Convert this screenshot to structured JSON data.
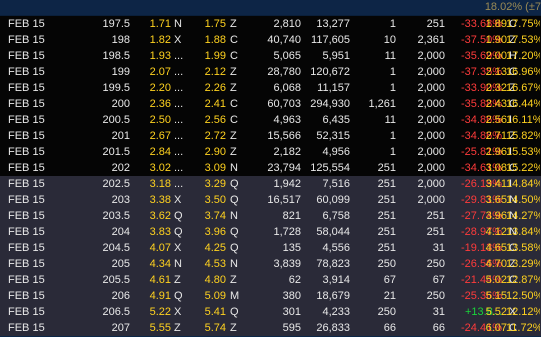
{
  "header": {
    "top_value": "18.02% (±7"
  },
  "rows": [
    {
      "exp": "FEB 15",
      "strike": "197.5",
      "bid": "1.71",
      "bid_x": "N",
      "ask": "1.75",
      "ask_x": "Z",
      "volume": "2,810",
      "open_int": "13,277",
      "size1": "1",
      "size2": "251",
      "pct_chg": "-33.68%",
      "last": "1.89",
      "last_x": "C",
      "iv": "17.75%",
      "zone": "itm"
    },
    {
      "exp": "FEB 15",
      "strike": "198",
      "bid": "1.82",
      "bid_x": "X",
      "ask": "1.88",
      "ask_x": "C",
      "volume": "40,740",
      "open_int": "117,605",
      "size1": "10",
      "size2": "2,361",
      "pct_chg": "-37.50%",
      "last": "1.90",
      "last_x": "Z",
      "iv": "17.53%",
      "zone": "itm"
    },
    {
      "exp": "FEB 15",
      "strike": "198.5",
      "bid": "1.93",
      "bid_x": "...",
      "ask": "1.99",
      "ask_x": "C",
      "volume": "5,065",
      "open_int": "5,951",
      "size1": "11",
      "size2": "2,000",
      "pct_chg": "-35.69%",
      "last": "2.00",
      "last_x": "H",
      "iv": "17.20%",
      "zone": "itm"
    },
    {
      "exp": "FEB 15",
      "strike": "199",
      "bid": "2.07",
      "bid_x": "...",
      "ask": "2.12",
      "ask_x": "Z",
      "volume": "28,780",
      "open_int": "120,672",
      "size1": "1",
      "size2": "2,000",
      "pct_chg": "-37.35%",
      "last": "2.13",
      "last_x": "C",
      "iv": "16.96%",
      "zone": "itm"
    },
    {
      "exp": "FEB 15",
      "strike": "199.5",
      "bid": "2.20",
      "bid_x": "...",
      "ask": "2.26",
      "ask_x": "Z",
      "volume": "6,068",
      "open_int": "11,157",
      "size1": "1",
      "size2": "2,000",
      "pct_chg": "-33.90%",
      "last": "2.32",
      "last_x": "Z",
      "iv": "16.67%",
      "zone": "itm"
    },
    {
      "exp": "FEB 15",
      "strike": "200",
      "bid": "2.36",
      "bid_x": "...",
      "ask": "2.41",
      "ask_x": "C",
      "volume": "60,703",
      "open_int": "294,930",
      "size1": "1,261",
      "size2": "2,000",
      "pct_chg": "-35.88%",
      "last": "2.43",
      "last_x": "C",
      "iv": "16.44%",
      "zone": "itm"
    },
    {
      "exp": "FEB 15",
      "strike": "200.5",
      "bid": "2.50",
      "bid_x": "...",
      "ask": "2.56",
      "ask_x": "C",
      "volume": "4,963",
      "open_int": "6,435",
      "size1": "11",
      "size2": "2,000",
      "pct_chg": "-34.86%",
      "last": "2.56",
      "last_x": "I",
      "iv": "16.11%",
      "zone": "itm"
    },
    {
      "exp": "FEB 15",
      "strike": "201",
      "bid": "2.67",
      "bid_x": "...",
      "ask": "2.72",
      "ask_x": "Z",
      "volume": "15,566",
      "open_int": "52,315",
      "size1": "1",
      "size2": "2,000",
      "pct_chg": "-34.86%",
      "last": "2.71",
      "last_x": "Z",
      "iv": "15.82%",
      "zone": "itm"
    },
    {
      "exp": "FEB 15",
      "strike": "201.5",
      "bid": "2.84",
      "bid_x": "...",
      "ask": "2.90",
      "ask_x": "Z",
      "volume": "2,182",
      "open_int": "4,956",
      "size1": "1",
      "size2": "2,000",
      "pct_chg": "-25.81%",
      "last": "2.96",
      "last_x": "I",
      "iv": "15.53%",
      "zone": "itm"
    },
    {
      "exp": "FEB 15",
      "strike": "202",
      "bid": "3.02",
      "bid_x": "...",
      "ask": "3.09",
      "ask_x": "N",
      "volume": "23,794",
      "open_int": "125,554",
      "size1": "251",
      "size2": "2,000",
      "pct_chg": "-34.61%",
      "last": "3.08",
      "last_x": "C",
      "iv": "15.22%",
      "zone": "itm"
    },
    {
      "exp": "FEB 15",
      "strike": "202.5",
      "bid": "3.18",
      "bid_x": "...",
      "ask": "3.29",
      "ask_x": "Q",
      "volume": "1,942",
      "open_int": "7,516",
      "size1": "251",
      "size2": "2,000",
      "pct_chg": "-26.19%",
      "last": "3.41",
      "last_x": "I",
      "iv": "14.84%",
      "zone": "otm"
    },
    {
      "exp": "FEB 15",
      "strike": "203",
      "bid": "3.38",
      "bid_x": "X",
      "ask": "3.50",
      "ask_x": "Q",
      "volume": "16,517",
      "open_int": "60,099",
      "size1": "251",
      "size2": "2,000",
      "pct_chg": "-29.81%",
      "last": "3.65",
      "last_x": "N",
      "iv": "14.50%",
      "zone": "otm"
    },
    {
      "exp": "FEB 15",
      "strike": "203.5",
      "bid": "3.62",
      "bid_x": "Q",
      "ask": "3.74",
      "ask_x": "N",
      "volume": "821",
      "open_int": "6,758",
      "size1": "251",
      "size2": "251",
      "pct_chg": "-27.74%",
      "last": "3.96",
      "last_x": "N",
      "iv": "14.27%",
      "zone": "otm"
    },
    {
      "exp": "FEB 15",
      "strike": "204",
      "bid": "3.83",
      "bid_x": "Q",
      "ask": "3.96",
      "ask_x": "Q",
      "volume": "1,728",
      "open_int": "58,044",
      "size1": "251",
      "size2": "251",
      "pct_chg": "-28.97%",
      "last": "4.12",
      "last_x": "N",
      "iv": "13.84%",
      "zone": "otm"
    },
    {
      "exp": "FEB 15",
      "strike": "204.5",
      "bid": "4.07",
      "bid_x": "X",
      "ask": "4.25",
      "ask_x": "Q",
      "volume": "135",
      "open_int": "4,556",
      "size1": "251",
      "size2": "31",
      "pct_chg": "-19.13%",
      "last": "4.65",
      "last_x": "C",
      "iv": "13.58%",
      "zone": "otm"
    },
    {
      "exp": "FEB 15",
      "strike": "205",
      "bid": "4.34",
      "bid_x": "N",
      "ask": "4.53",
      "ask_x": "N",
      "volume": "3,839",
      "open_int": "78,823",
      "size1": "250",
      "size2": "250",
      "pct_chg": "-26.56%",
      "last": "4.70",
      "last_x": "Z",
      "iv": "13.29%",
      "zone": "otm"
    },
    {
      "exp": "FEB 15",
      "strike": "205.5",
      "bid": "4.61",
      "bid_x": "Z",
      "ask": "4.80",
      "ask_x": "Z",
      "volume": "62",
      "open_int": "3,914",
      "size1": "67",
      "size2": "67",
      "pct_chg": "-21.44%",
      "last": "5.02",
      "last_x": "C",
      "iv": "12.87%",
      "zone": "otm"
    },
    {
      "exp": "FEB 15",
      "strike": "206",
      "bid": "4.91",
      "bid_x": "Q",
      "ask": "5.09",
      "ask_x": "M",
      "volume": "380",
      "open_int": "18,679",
      "size1": "21",
      "size2": "250",
      "pct_chg": "-25.36%",
      "last": "5.15",
      "last_x": "...",
      "iv": "12.50%",
      "zone": "otm"
    },
    {
      "exp": "FEB 15",
      "strike": "206.5",
      "bid": "5.22",
      "bid_x": "X",
      "ask": "5.41",
      "ask_x": "Q",
      "volume": "301",
      "open_int": "4,233",
      "size1": "250",
      "size2": "31",
      "pct_chg": "+13.8...",
      "last": "5.52",
      "last_x": "X",
      "iv": "12.12%",
      "zone": "otm"
    },
    {
      "exp": "FEB 15",
      "strike": "207",
      "bid": "5.55",
      "bid_x": "Z",
      "ask": "5.74",
      "ask_x": "Z",
      "volume": "595",
      "open_int": "26,833",
      "size1": "66",
      "size2": "66",
      "pct_chg": "-24.41%",
      "last": "6.07",
      "last_x": "C",
      "iv": "11.72%",
      "zone": "otm"
    }
  ]
}
